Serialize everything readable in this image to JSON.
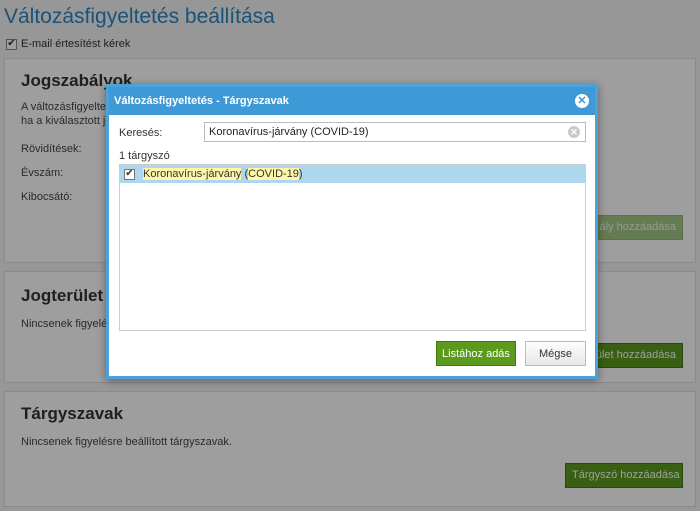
{
  "page": {
    "title": "Változásfigyeltetés beállítása",
    "email_label": "E-mail értesítést kérek"
  },
  "sections": {
    "laws": {
      "title": "Jogszabályok",
      "desc_line1": "A változásfigyeltetés",
      "desc_line2": "ha a kiválasztott jog",
      "field_abbrev": "Rövidítések:",
      "field_year": "Évszám:",
      "field_issuer": "Kibocsátó:",
      "add_button_visible": "ály hozzáadása"
    },
    "fields": {
      "title": "Jogterület",
      "desc": "Nincsenek figyelés",
      "add_button_visible": "ület hozzáadása"
    },
    "topics": {
      "title": "Tárgyszavak",
      "desc": "Nincsenek figyelésre beállított tárgyszavak.",
      "add_button": "Tárgyszó hozzáadása"
    }
  },
  "dialog": {
    "title": "Változásfigyeltetés - Tárgyszavak",
    "search_label": "Keresés:",
    "search_value": "Koronavírus-járvány (COVID-19)",
    "result_count": "1 tárgyszó",
    "results": [
      {
        "part1": "Koronavírus-járvány",
        "part2": " ",
        "part3": "(",
        "part4": "COVID-19",
        "part5": ")",
        "checked": true
      }
    ],
    "add_to_list_button": "Listához adás",
    "cancel_button": "Mégse"
  },
  "colors": {
    "accent": "#3e9ad6",
    "green": "#5b9a1d",
    "highlight": "#fff8a8",
    "selected_row": "#add6ef"
  },
  "icons": {
    "checkbox": "checkmark",
    "close": "close-icon",
    "clear": "clear-icon"
  }
}
